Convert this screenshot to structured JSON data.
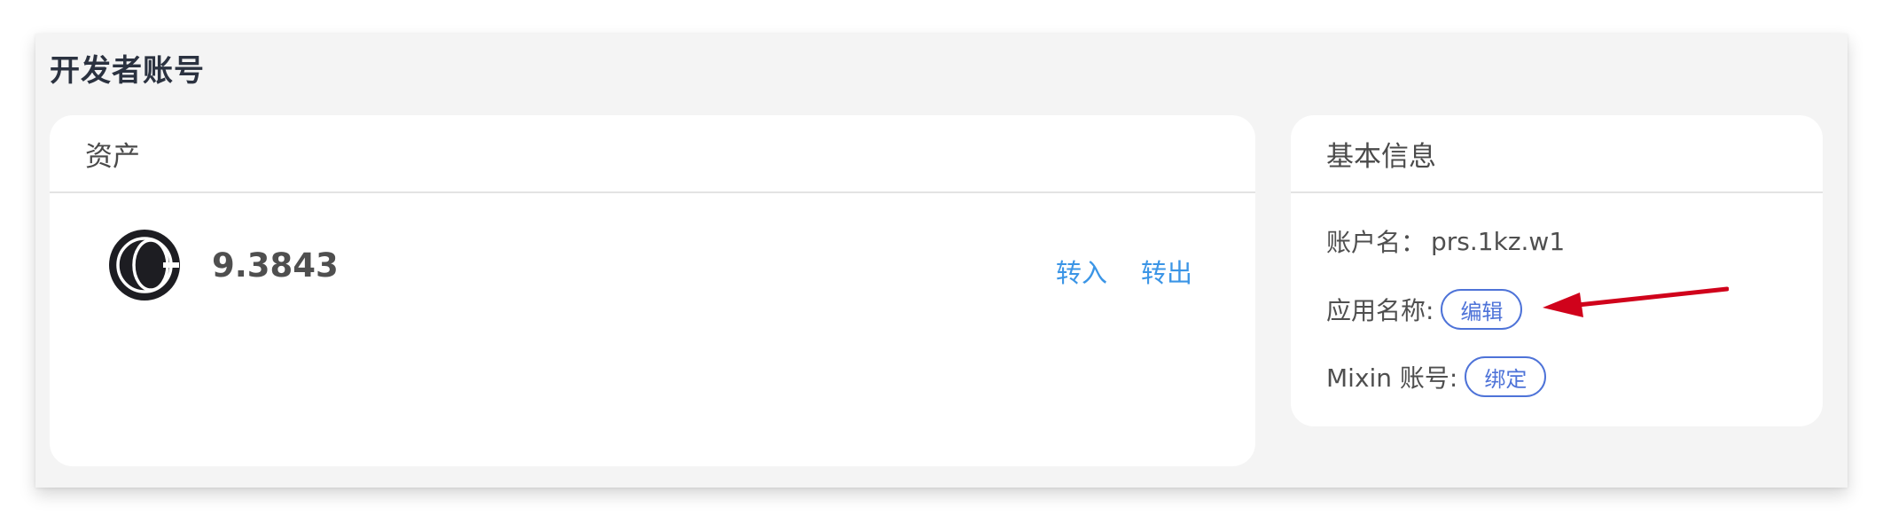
{
  "page": {
    "title": "开发者账号"
  },
  "assets_card": {
    "header": "资产",
    "asset": {
      "icon": "prs-coin-icon",
      "amount": "9.3843",
      "deposit_label": "转入",
      "withdraw_label": "转出"
    }
  },
  "info_card": {
    "header": "基本信息",
    "account_name_label": "账户名：",
    "account_name_value": "prs.1kz.w1",
    "app_name_label": "应用名称:",
    "edit_label": "编辑",
    "mixin_label": "Mixin 账号:",
    "bind_label": "绑定"
  },
  "annotation": {
    "icon": "red-arrow-icon",
    "color": "#d0021b"
  },
  "colors": {
    "link": "#3b95e6",
    "pill_border": "#4e73d8",
    "background": "#f4f4f4"
  }
}
